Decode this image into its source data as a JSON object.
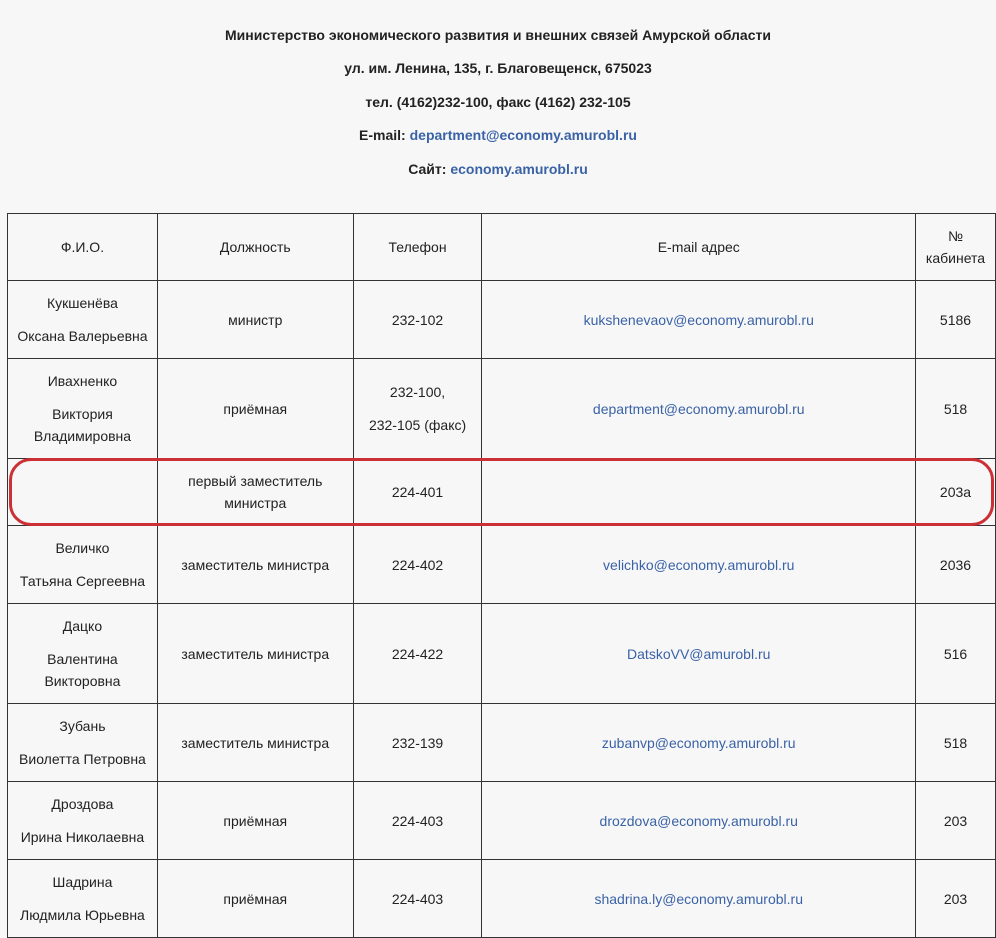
{
  "header": {
    "org_name": "Министерство экономического развития и внешних связей Амурской области",
    "address": "ул. им. Ленина, 135, г. Благовещенск, 675023",
    "phone": "тел. (4162)232-100, факс (4162) 232-105",
    "email_label": "E-mail: ",
    "email_link": "department@economy.amurobl.ru",
    "site_label": "Сайт: ",
    "site_link": "economy.amurobl.ru"
  },
  "table": {
    "columns": [
      "Ф.И.О.",
      "Должность",
      "Телефон",
      "E-mail адрес",
      "№ кабинета"
    ],
    "rows": [
      {
        "name": [
          "Кукшенёва",
          "Оксана Валерьевна"
        ],
        "position": "министр",
        "phone": [
          "232-102"
        ],
        "email": "kukshenevaov@economy.amurobl.ru",
        "room": "5186"
      },
      {
        "name": [
          "Ивахненко",
          "Виктория",
          "Владимировна"
        ],
        "position": "приёмная",
        "phone": [
          "232-100,",
          "232-105 (факс)"
        ],
        "email": "department@economy.amurobl.ru",
        "room": "518"
      },
      {
        "name": [],
        "position": "первый заместитель министра",
        "phone": [
          "224-401"
        ],
        "email": "",
        "room": "203а"
      },
      {
        "name": [
          "Величко",
          "Татьяна Сергеевна"
        ],
        "position": "заместитель министра",
        "phone": [
          "224-402"
        ],
        "email": "velichko@economy.amurobl.ru",
        "room": "2036"
      },
      {
        "name": [
          "Дацко",
          "Валентина",
          "Викторовна"
        ],
        "position": "заместитель министра",
        "phone": [
          "224-422"
        ],
        "email": "DatskoVV@amurobl.ru",
        "room": "516"
      },
      {
        "name": [
          "Зубань",
          "Виолетта Петровна"
        ],
        "position": "заместитель министра",
        "phone": [
          "232-139"
        ],
        "email": "zubanvp@economy.amurobl.ru",
        "room": "518"
      },
      {
        "name": [
          "Дроздова",
          "Ирина Николаевна"
        ],
        "position": "приёмная",
        "phone": [
          "224-403"
        ],
        "email": "drozdova@economy.amurobl.ru",
        "room": "203"
      },
      {
        "name": [
          "Шадрина",
          "Людмила Юрьевна"
        ],
        "position": "приёмная",
        "phone": [
          "224-403"
        ],
        "email": "shadrina.ly@economy.amurobl.ru",
        "room": "203"
      }
    ]
  },
  "highlight_color": "#cc2f36",
  "link_color": "#3a62a7"
}
